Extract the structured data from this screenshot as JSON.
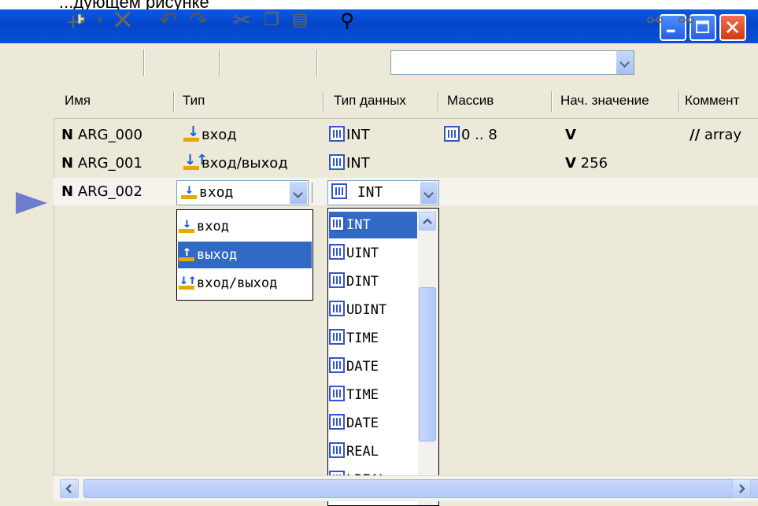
{
  "caption_fragment": "...дующем рисунке",
  "window": {
    "buttons": [
      "minimize",
      "maximize",
      "close"
    ]
  },
  "toolbar": {
    "icons": [
      "new-variable-icon",
      "dropdown-arrow-icon",
      "delete-icon",
      "undo-icon",
      "redo-icon",
      "cut-icon",
      "copy-icon",
      "paste-icon",
      "find-icon",
      "replace-icon",
      "replace-all-icon"
    ],
    "search_value": ""
  },
  "columns": {
    "name": "Имя",
    "type": "Тип",
    "datatype": "Тип данных",
    "array": "Массив",
    "initial": "Нач. значение",
    "comment": "Коммент"
  },
  "rows": [
    {
      "marker": "N",
      "name": "ARG_000",
      "type": "вход",
      "datatype": "INT",
      "array": "0 .. 8",
      "init_marker": "V",
      "initial": "",
      "comment_marker": "//",
      "comment": "array"
    },
    {
      "marker": "N",
      "name": "ARG_001",
      "type": "вход/выход",
      "datatype": "INT",
      "array": "",
      "init_marker": "V",
      "initial": "256",
      "comment_marker": "",
      "comment": ""
    },
    {
      "marker": "N",
      "name": "ARG_002",
      "type": "вход",
      "datatype": "INT",
      "array": "",
      "init_marker": "",
      "initial": "",
      "comment_marker": "",
      "comment": ""
    }
  ],
  "type_combo": {
    "value": "вход",
    "options": [
      "вход",
      "выход",
      "вход/выход"
    ],
    "selected": "выход"
  },
  "datatype_combo": {
    "value": "INT",
    "options": [
      "INT",
      "UINT",
      "DINT",
      "UDINT",
      "TIME",
      "DATE",
      "TIME",
      "DATE",
      "REAL",
      "LREAL"
    ],
    "selected": "INT"
  },
  "colors": {
    "titlebar": "#0446c8",
    "selection": "#316ac5",
    "pointer": "#6d7ed0"
  }
}
